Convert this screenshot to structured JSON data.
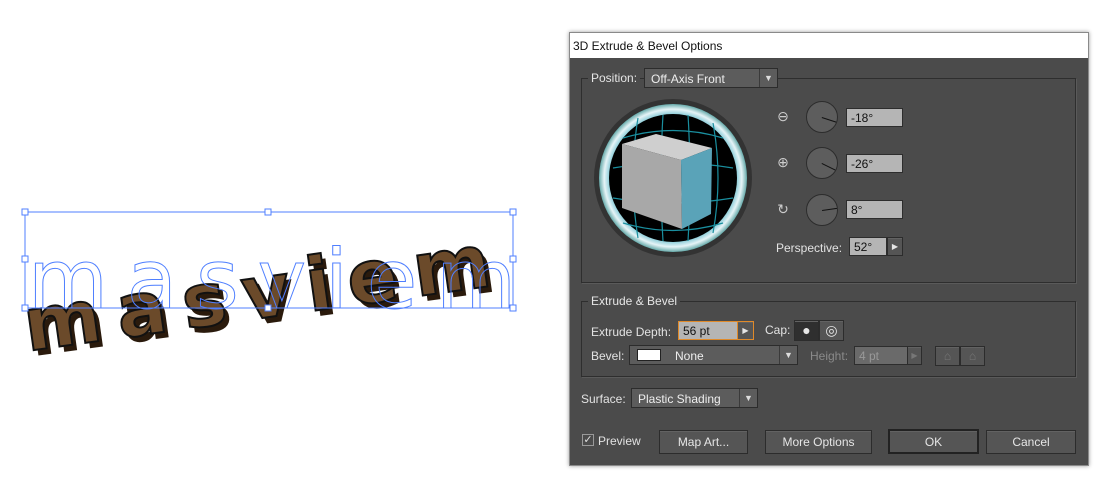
{
  "artwork": {
    "text": "masviem",
    "fill": "#6b4a2a",
    "selection_color": "#4f7fff"
  },
  "dialog": {
    "title": "3D Extrude & Bevel Options",
    "position": {
      "label": "Position:",
      "value": "Off-Axis Front"
    },
    "rotation": {
      "x": "-18°",
      "y": "-26°",
      "z": "8°"
    },
    "perspective": {
      "label": "Perspective:",
      "value": "52°"
    },
    "extrude_bevel": {
      "group_label": "Extrude & Bevel",
      "depth_label": "Extrude Depth:",
      "depth_value": "56 pt",
      "cap_label": "Cap:",
      "bevel_label": "Bevel:",
      "bevel_value": "None",
      "height_label": "Height:",
      "height_value": "4 pt"
    },
    "surface": {
      "label": "Surface:",
      "value": "Plastic Shading"
    },
    "preview": {
      "label": "Preview",
      "checked": true
    },
    "buttons": {
      "map_art": "Map Art...",
      "more_options": "More Options",
      "ok": "OK",
      "cancel": "Cancel"
    },
    "colors": {
      "cube_front": "#5aa3b8",
      "cube_side": "#a8a8a8",
      "cube_top": "#cfcfcf",
      "focus": "#e08a2a"
    }
  }
}
